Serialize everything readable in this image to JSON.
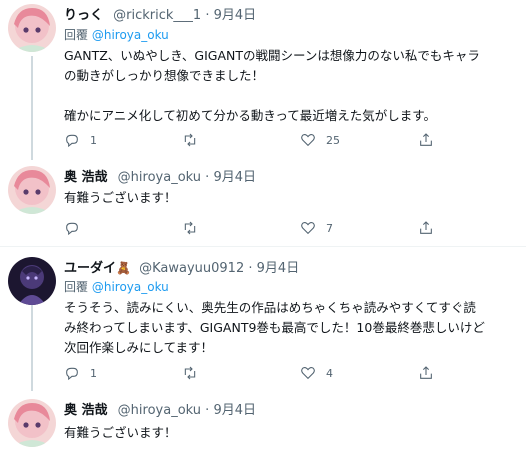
{
  "tweets": [
    {
      "name": "りっく",
      "handle": "@rickrick___1",
      "sep": "·",
      "date": "9月4日",
      "reply_prefix": "回覆",
      "reply_to": "@hiroya_oku",
      "lines": [
        "GANTZ、いぬやしき、GIGANTの戦闘シーンは想像力のない私でもキャラ",
        "の動きがしっかり想像できました！",
        "",
        "確かにアニメ化して初めて分かる動きって最近増えた気がします。"
      ],
      "reply_count": "1",
      "retweet_count": "",
      "like_count": "25"
    },
    {
      "name": "奥 浩哉",
      "handle": "@hiroya_oku",
      "sep": "·",
      "date": "9月4日",
      "lines": [
        "有難うございます！"
      ],
      "reply_count": "",
      "retweet_count": "",
      "like_count": "7"
    },
    {
      "name": "ユーダイ",
      "name_emoji": "🧸",
      "handle": "@Kawayuu0912",
      "sep": "·",
      "date": "9月4日",
      "reply_prefix": "回覆",
      "reply_to": "@hiroya_oku",
      "lines": [
        "そうそう、読みにくい、奥先生の作品はめちゃくちゃ読みやすくてすぐ読",
        "み終わってしまいます、GIGANT9巻も最高でした！10巻最終巻悲しいけど",
        "次回作楽しみにしてます！"
      ],
      "reply_count": "1",
      "retweet_count": "",
      "like_count": "4"
    },
    {
      "name": "奥 浩哉",
      "handle": "@hiroya_oku",
      "sep": "·",
      "date": "9月4日",
      "lines": [
        "有難うございます！"
      ]
    }
  ],
  "icons": [
    "reply-icon",
    "retweet-icon",
    "like-icon",
    "share-icon"
  ],
  "colors": {
    "link": "#1d9bf0",
    "muted": "#536471",
    "text": "#0f1419",
    "divider": "#eff3f4",
    "thread_line": "#cfd9de"
  }
}
